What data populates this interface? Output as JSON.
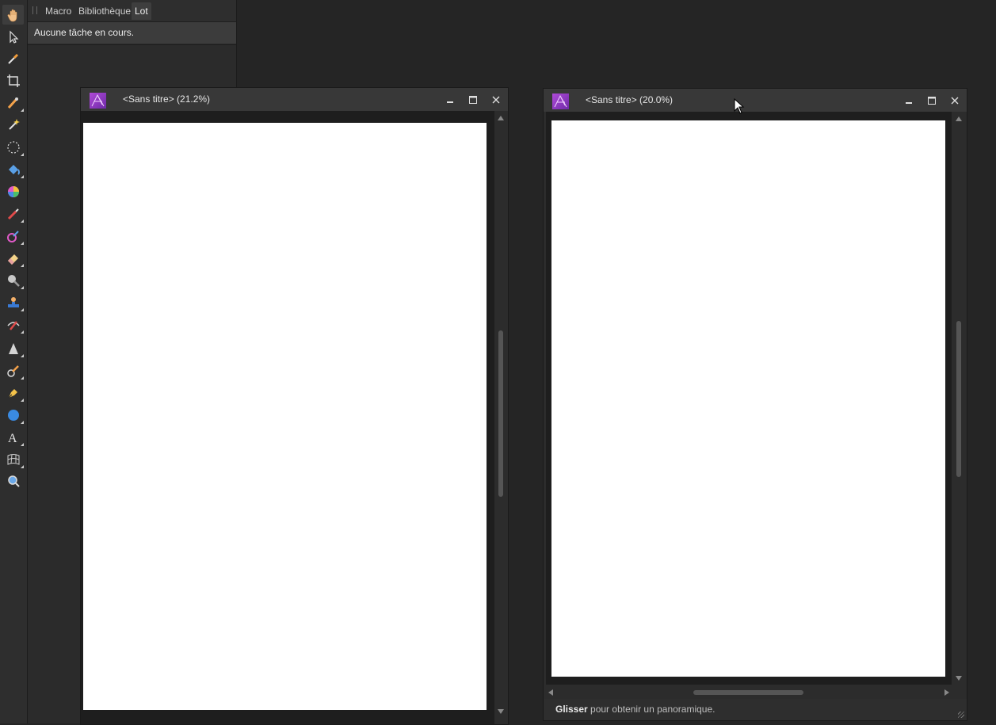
{
  "toolbar": {
    "tools": [
      {
        "name": "view-tool",
        "icon": "hand-icon",
        "active": true
      },
      {
        "name": "move-tool",
        "icon": "arrow-icon"
      },
      {
        "name": "color-picker-tool",
        "icon": "eyedropper-icon"
      },
      {
        "name": "crop-tool",
        "icon": "crop-icon"
      },
      {
        "name": "selection-brush-tool",
        "icon": "selection-brush-icon",
        "flyout": true
      },
      {
        "name": "flood-select-tool",
        "icon": "magic-wand-icon"
      },
      {
        "name": "marquee-tool",
        "icon": "marquee-icon",
        "flyout": true
      },
      {
        "name": "flood-fill-tool",
        "icon": "paint-bucket-icon",
        "flyout": true
      },
      {
        "name": "color-wheel-tool",
        "icon": "color-wheel-icon"
      },
      {
        "name": "paint-brush-tool",
        "icon": "paint-brush-icon",
        "flyout": true
      },
      {
        "name": "color-replacement-tool",
        "icon": "color-replace-icon",
        "flyout": true
      },
      {
        "name": "erase-brush-tool",
        "icon": "eraser-icon",
        "flyout": true
      },
      {
        "name": "dodge-tool",
        "icon": "dodge-icon",
        "flyout": true
      },
      {
        "name": "clone-tool",
        "icon": "stamp-icon",
        "flyout": true
      },
      {
        "name": "red-eye-tool",
        "icon": "healing-icon",
        "flyout": true
      },
      {
        "name": "blur-brush-tool",
        "icon": "cone-icon",
        "flyout": true
      },
      {
        "name": "smudge-tool",
        "icon": "smudge-brush-icon",
        "flyout": true
      },
      {
        "name": "pen-tool",
        "icon": "pen-nib-icon",
        "flyout": true
      },
      {
        "name": "shape-tool",
        "icon": "ellipse-icon",
        "flyout": true
      },
      {
        "name": "text-tool",
        "icon": "text-icon",
        "flyout": true
      },
      {
        "name": "mesh-warp-tool",
        "icon": "mesh-icon",
        "flyout": true
      },
      {
        "name": "zoom-tool",
        "icon": "zoom-icon"
      }
    ]
  },
  "studio": {
    "tabs": [
      "Macro",
      "Bibliothèque",
      "Lot"
    ],
    "active_tab": "Lot",
    "status": "Aucune tâche en cours."
  },
  "windows": [
    {
      "title": "<Sans titre> (21.2%)"
    },
    {
      "title": "<Sans titre> (20.0%)"
    }
  ],
  "statusbar": {
    "bold": "Glisser",
    "text": " pour obtenir un panoramique."
  },
  "colors": {
    "background": "#252525",
    "panel": "#2b2b2b",
    "titlebar": "#383838",
    "page": "#ffffff",
    "accent": "#b04ad8"
  }
}
